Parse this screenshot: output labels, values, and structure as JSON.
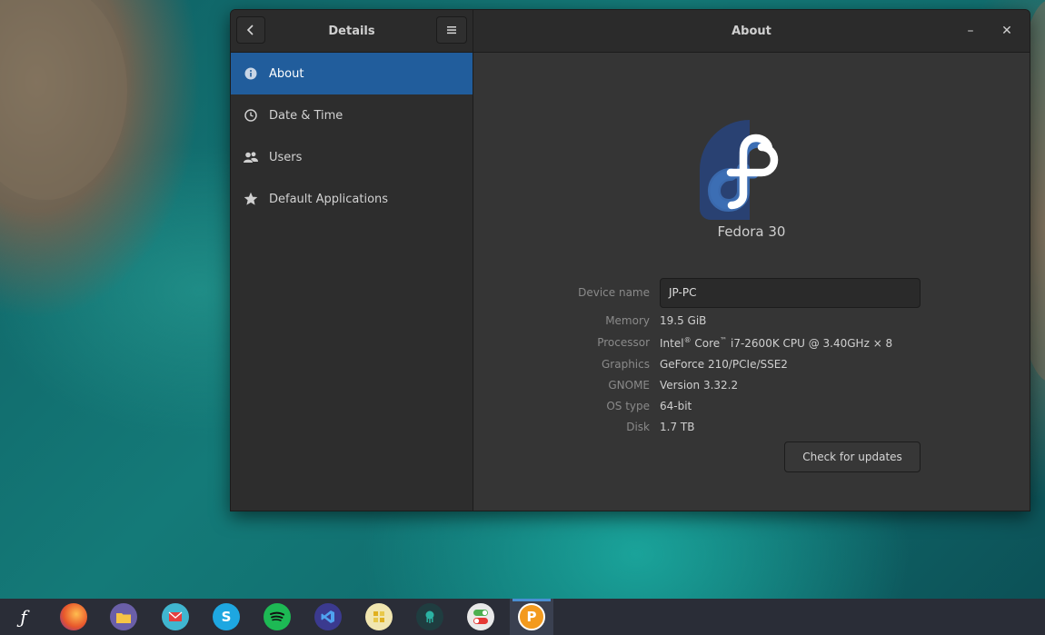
{
  "window": {
    "sidebar_title": "Details",
    "main_title": "About",
    "minimize_glyph": "–",
    "close_glyph": "✕"
  },
  "sidebar": {
    "items": [
      {
        "label": "About",
        "icon": "info-icon",
        "active": true
      },
      {
        "label": "Date & Time",
        "icon": "clock-icon",
        "active": false
      },
      {
        "label": "Users",
        "icon": "users-icon",
        "active": false
      },
      {
        "label": "Default Applications",
        "icon": "star-icon",
        "active": false
      }
    ]
  },
  "about": {
    "distro": "Fedora 30",
    "device_name_label": "Device name",
    "device_name_value": "JP-PC",
    "specs": [
      {
        "key": "Memory",
        "value": "19.5 GiB"
      },
      {
        "key": "Processor",
        "value_parts": [
          "Intel",
          "®",
          " Core",
          "™",
          " i7-2600K CPU @ 3.40GHz × 8"
        ]
      },
      {
        "key": "Graphics",
        "value": "GeForce 210/PCIe/SSE2"
      },
      {
        "key": "GNOME",
        "value": "Version 3.32.2"
      },
      {
        "key": "OS type",
        "value": "64-bit"
      },
      {
        "key": "Disk",
        "value": "1.7 TB"
      }
    ],
    "update_button": "Check for updates"
  },
  "taskbar": {
    "apps": [
      {
        "name": "fedora-launcher",
        "glyph": "ƒ",
        "color": "#2a2d37"
      },
      {
        "name": "firefox",
        "glyph": "",
        "color": "#e8572b"
      },
      {
        "name": "files",
        "glyph": "",
        "color": "#6a5fa8"
      },
      {
        "name": "mail",
        "glyph": "",
        "color": "#40b6d0"
      },
      {
        "name": "skype",
        "glyph": "S",
        "color": "#1ea7e1"
      },
      {
        "name": "spotify",
        "glyph": "",
        "color": "#1db954"
      },
      {
        "name": "visual-studio-code",
        "glyph": "",
        "color": "#3b3a8f"
      },
      {
        "name": "notes",
        "glyph": "",
        "color": "#f1e6b0"
      },
      {
        "name": "gitkraken",
        "glyph": "",
        "color": "#1f3d40"
      },
      {
        "name": "settings-toggle",
        "glyph": "",
        "color": "#e9e9e9"
      },
      {
        "name": "pinta",
        "glyph": "P",
        "color": "#f39a1e"
      }
    ]
  },
  "colors": {
    "accent": "#215d9c",
    "fedora_blue": "#294172",
    "fedora_light": "#3c6eb4"
  }
}
